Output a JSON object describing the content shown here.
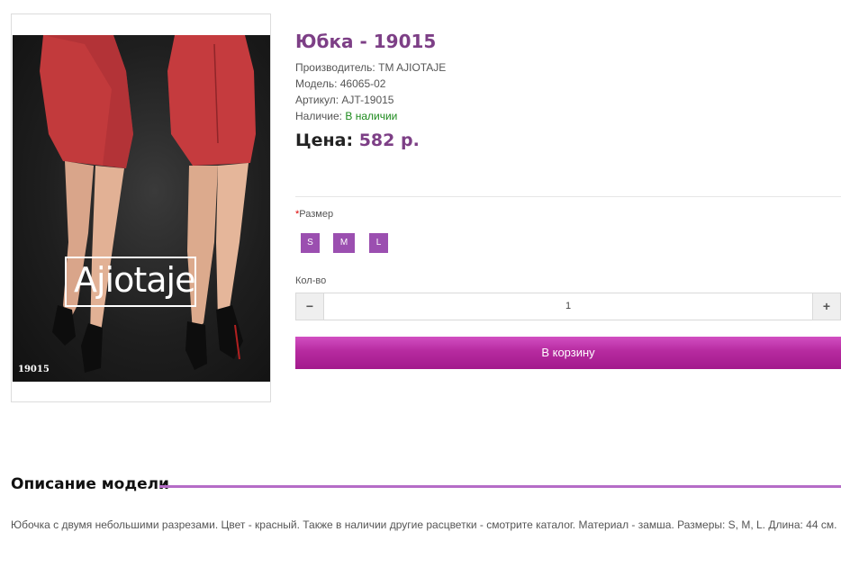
{
  "product": {
    "title": "Юбка - 19015",
    "manufacturer_label": "Производитель:",
    "manufacturer_value": "TM AJIOTAJE",
    "model_label": "Модель:",
    "model_value": "46065-02",
    "article_label": "Артикул:",
    "article_value": "AJT-19015",
    "stock_label": "Наличие:",
    "stock_value": "В наличии",
    "price_label": "Цена:",
    "price_value": "582 р."
  },
  "image": {
    "brand": "Ajiotaje",
    "code": "19015"
  },
  "options": {
    "required_mark": "*",
    "size_label": "Размер",
    "sizes": [
      "S",
      "M",
      "L"
    ]
  },
  "quantity": {
    "label": "Кол-во",
    "value": "1",
    "minus": "−",
    "plus": "+"
  },
  "cart": {
    "button_label": "В корзину"
  },
  "description": {
    "title": "Описание модели",
    "text": "Юбочка с двумя небольшими разрезами. Цвет - красный. Также в наличии другие расцветки - смотрите каталог. Материал - замша. Размеры: S, M, L. Длина: 44 см."
  },
  "colors": {
    "accent": "#7d3f86",
    "size_button": "#9b4fb0",
    "cart_button": "#b62a9f",
    "in_stock": "#1c8a1c"
  }
}
